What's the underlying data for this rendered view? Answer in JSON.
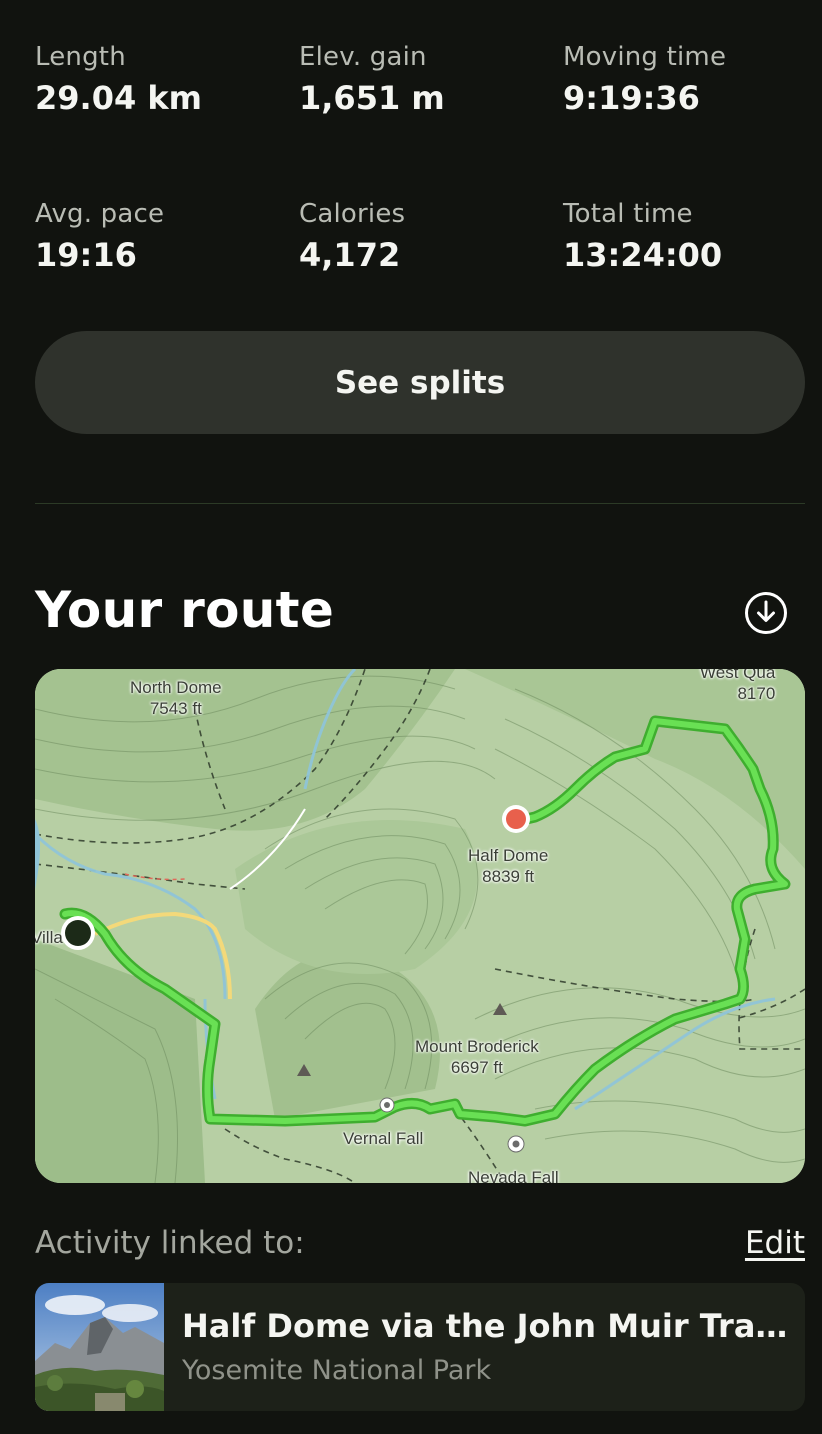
{
  "stats": [
    {
      "label": "Length",
      "value": "29.04 km"
    },
    {
      "label": "Elev. gain",
      "value": "1,651 m"
    },
    {
      "label": "Moving time",
      "value": "9:19:36"
    },
    {
      "label": "Avg. pace",
      "value": "19:16"
    },
    {
      "label": "Calories",
      "value": "4,172"
    },
    {
      "label": "Total time",
      "value": "13:24:00"
    }
  ],
  "splits_button": "See splits",
  "route": {
    "title": "Your route",
    "download_icon": "download-circle-icon"
  },
  "map": {
    "labels": {
      "north_dome": "North Dome",
      "north_dome_elev": "7543 ft",
      "half_dome": "Half Dome",
      "half_dome_elev": "8839 ft",
      "mount_broderick": "Mount Broderick",
      "mount_broderick_elev": "6697 ft",
      "vernal_fall": "Vernal Fall",
      "nevada_fall": "Nevada Fall",
      "west_quarter": "West Qua",
      "west_quarter_elev": "8170",
      "village": "Villa"
    },
    "colors": {
      "terrain": "#b7cfa4",
      "route": "#5ed64a",
      "end_marker": "#e8604c",
      "start_marker": "#1c2a18",
      "water": "#8fc4d8",
      "road": "#f3d97a"
    }
  },
  "linked": {
    "label": "Activity linked to:",
    "edit": "Edit"
  },
  "trail": {
    "name": "Half Dome via the John Muir Trail (J...",
    "park": "Yosemite National Park"
  }
}
